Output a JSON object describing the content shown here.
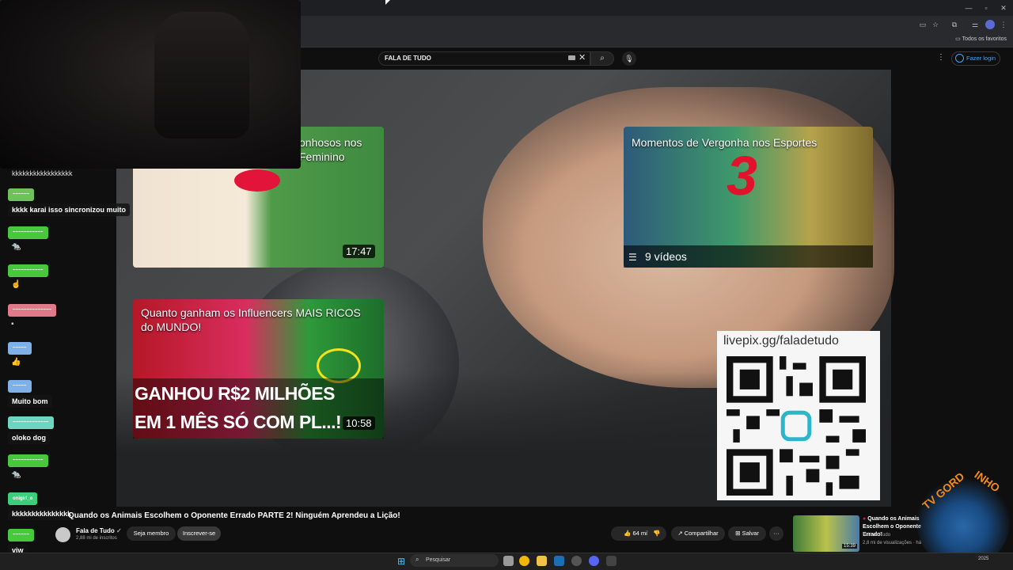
{
  "browser": {
    "bookmarks_folder_label": "Todos os favoritos"
  },
  "youtube": {
    "search": {
      "value": "FALA DE TUDO"
    },
    "login_label": "Fazer login"
  },
  "video_cards": [
    {
      "title_fragment": "onhosos nos\nFeminino",
      "duration": "17:47"
    },
    {
      "title": "Quanto ganham os Influencers MAIS RICOS do MUNDO!",
      "caption_line1": "GANHOU R$2 MILHÕES",
      "caption_line2": "EM 1 MÊS SÓ COM PL...!",
      "duration": "10:58"
    },
    {
      "title": "Momentos de Vergonha nos Esportes",
      "number": "3",
      "count_label": "9 vídeos"
    }
  ],
  "qr": {
    "url": "livepix.gg/faladetudo"
  },
  "chat": {
    "top_text": "kkkkkkkkkkkkkkkkk",
    "messages": [
      {
        "user": "~~~~~~",
        "user_color": "#6fc25a",
        "text": "kkkk karai isso sincronizou muito"
      },
      {
        "user": "~~~~~~~~~~~",
        "user_color": "#46c93a",
        "emote": "🐀"
      },
      {
        "user": "~~~~~~~~~~~",
        "user_color": "#46c93a",
        "emote": "☝"
      },
      {
        "user": "~~~~~~~~~~~~~~",
        "user_color": "#e07a8a",
        "emote": "▪"
      },
      {
        "user": "~~~~~",
        "user_color": "#7fb1e8",
        "emote": "👍"
      },
      {
        "user": "~~~~~",
        "user_color": "#7fb1e8",
        "text": "Muito bom"
      },
      {
        "user": "~~~~~~~~~~~~~",
        "user_color": "#6dd6c0",
        "text": "oloko dog"
      },
      {
        "user": "~~~~~~~~~~~",
        "user_color": "#46c93a",
        "emote": "🐀"
      },
      {
        "user": "onigiri_o",
        "user_color": "#3acf7a",
        "text": "kkkkkkkkkkkkkkk"
      },
      {
        "user": "~~~~~~",
        "user_color": "#46c93a",
        "text": "viw"
      }
    ]
  },
  "watch": {
    "title": "Quando os Animais Escolhem o Oponente Errado PARTE 2! Ninguém Aprendeu a Lição!",
    "channel_name": "Fala de Tudo",
    "channel_subs": "2,88 mi de inscritos",
    "member_label": "Seja membro",
    "subscribe_label": "Inscrever-se",
    "likes": "64 mil",
    "share_label": "Compartilhar",
    "save_label": "Salvar",
    "more_label": "···"
  },
  "recommended": {
    "title": "Quando os Animais Escolhem o Oponente Errado!",
    "channel": "Fala de Tudo",
    "views": "2,8 mi de visualizações · há",
    "duration": "15:39"
  },
  "logo": {
    "text_left": "TV GORD",
    "text_right": "INHO"
  },
  "taskbar": {
    "search_placeholder": "Pesquisar",
    "time": "2025"
  },
  "colors": {
    "youtube_bg": "#0f0f0f",
    "link_blue": "#3ea6ff",
    "card_red": "#e3112b"
  }
}
